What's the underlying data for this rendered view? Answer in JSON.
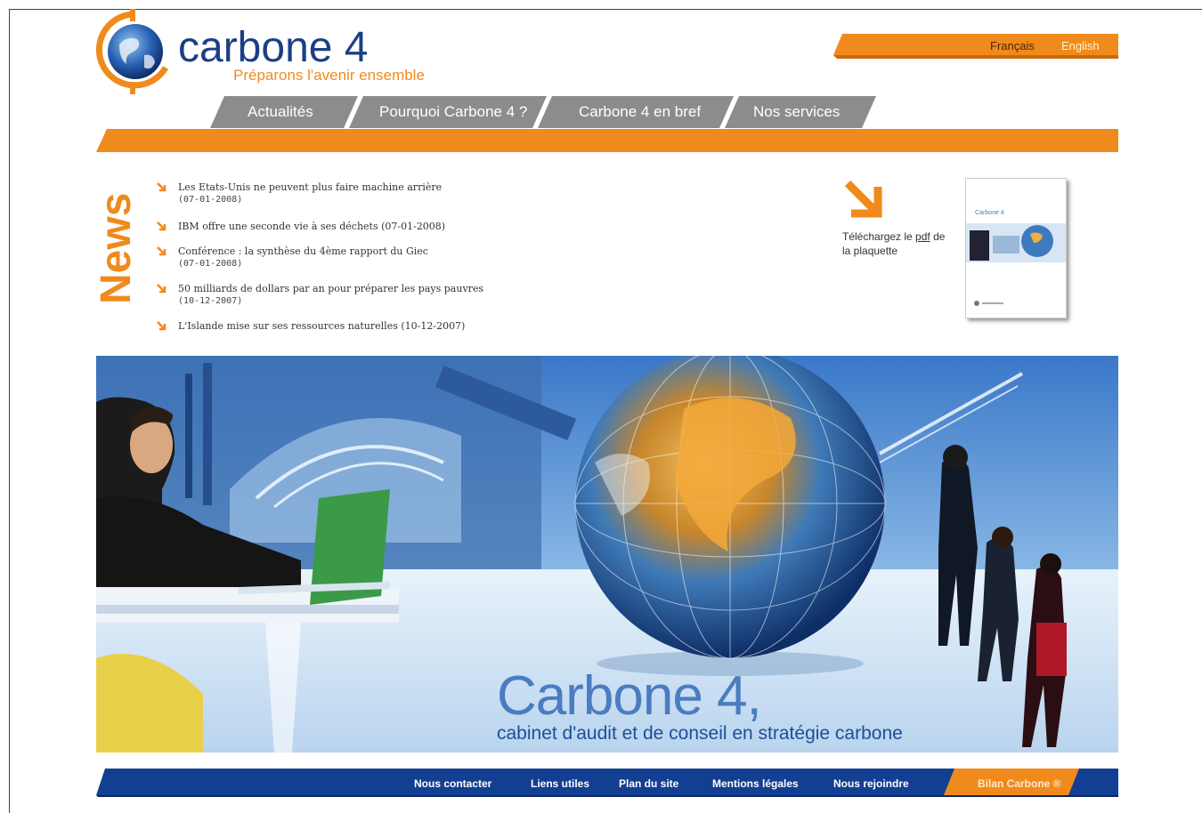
{
  "brand": {
    "name": "carbone 4",
    "tagline": "Préparons l'avenir ensemble",
    "orange": "#f08a1c",
    "blue": "#1b3f86"
  },
  "languages": [
    "Français",
    "English"
  ],
  "nav": [
    "Actualités",
    "Pourquoi Carbone 4 ?",
    "Carbone 4 en bref",
    "Nos services"
  ],
  "news": {
    "heading": "News",
    "items": [
      {
        "title": "Les Etats-Unis ne peuvent plus faire machine arrière",
        "date": "(07-01-2008)"
      },
      {
        "title": "IBM offre une seconde vie à ses déchets (07-01-2008)",
        "date": ""
      },
      {
        "title": "Conférence : la synthèse du 4ème rapport du Giec",
        "date": "(07-01-2008)"
      },
      {
        "title": "50 milliards de dollars par an pour préparer les pays pauvres",
        "date": "(10-12-2007)"
      },
      {
        "title": "L'Islande mise sur ses ressources naturelles (10-12-2007)",
        "date": ""
      }
    ]
  },
  "download": {
    "text_before": "Téléchargez le ",
    "link": "pdf",
    "text_after": " de la plaquette",
    "brochure_title": "Carbone 4"
  },
  "hero": {
    "title": "Carbone 4,",
    "subtitle": "cabinet d'audit et de conseil en stratégie carbone"
  },
  "footer": {
    "links": [
      "Nous contacter",
      "Liens utiles",
      "Plan du site",
      "Mentions légales",
      "Nous rejoindre"
    ],
    "bilan": "Bilan Carbone ®"
  }
}
